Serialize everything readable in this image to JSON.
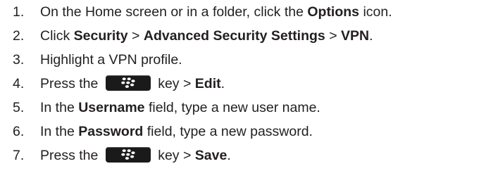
{
  "steps": [
    {
      "number": "1.",
      "parts": {
        "t1": "On the Home screen or in a folder, click the ",
        "b1": "Options",
        "t2": " icon."
      }
    },
    {
      "number": "2.",
      "parts": {
        "t1": "Click ",
        "b1": "Security",
        "t2": " > ",
        "b2": "Advanced Security Settings",
        "t3": " > ",
        "b3": "VPN",
        "t4": "."
      }
    },
    {
      "number": "3.",
      "parts": {
        "t1": "Highlight a VPN profile."
      }
    },
    {
      "number": "4.",
      "parts": {
        "t1": "Press the ",
        "icon": "blackberry-menu-key-icon",
        "t2": " key > ",
        "b1": "Edit",
        "t3": "."
      }
    },
    {
      "number": "5.",
      "parts": {
        "t1": "In the ",
        "b1": "Username",
        "t2": " field, type a new user name."
      }
    },
    {
      "number": "6.",
      "parts": {
        "t1": "In the ",
        "b1": "Password",
        "t2": " field, type a new password."
      }
    },
    {
      "number": "7.",
      "parts": {
        "t1": "Press the ",
        "icon": "blackberry-menu-key-icon",
        "t2": " key > ",
        "b1": "Save",
        "t3": "."
      }
    }
  ]
}
